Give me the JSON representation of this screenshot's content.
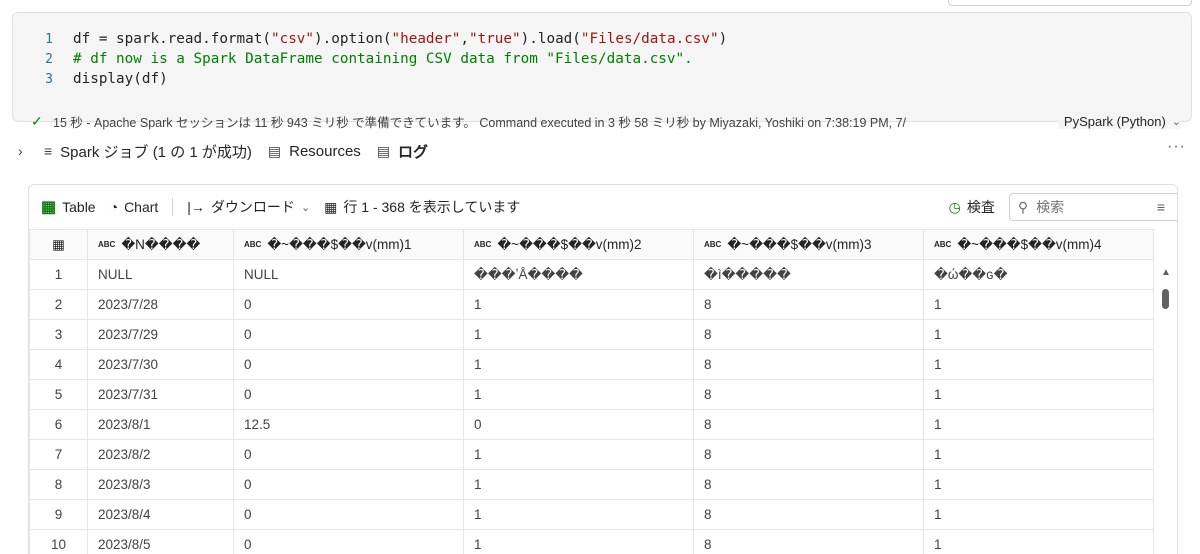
{
  "code": {
    "lines": [
      {
        "num": "1",
        "tokens": [
          {
            "t": "df = spark.read.format(",
            "c": "plain"
          },
          {
            "t": "\"csv\"",
            "c": "str"
          },
          {
            "t": ").option(",
            "c": "plain"
          },
          {
            "t": "\"header\"",
            "c": "str"
          },
          {
            "t": ",",
            "c": "plain"
          },
          {
            "t": "\"true\"",
            "c": "str"
          },
          {
            "t": ").load(",
            "c": "plain"
          },
          {
            "t": "\"Files/data.csv\"",
            "c": "str"
          },
          {
            "t": ")",
            "c": "plain"
          }
        ]
      },
      {
        "num": "2",
        "tokens": [
          {
            "t": "# df now is a Spark DataFrame containing CSV data from \"Files/data.csv\".",
            "c": "cmt"
          }
        ]
      },
      {
        "num": "3",
        "tokens": [
          {
            "t": "display(df)",
            "c": "plain"
          }
        ]
      }
    ]
  },
  "status": {
    "check_icon": "✓",
    "text": "15 秒 - Apache Spark セッションは 11 秒 943 ミリ秒 で準備できています。 Command executed in 3 秒 58 ミリ秒 by Miyazaki, Yoshiki on 7:38:19 PM, 7/",
    "language": "PySpark (Python)"
  },
  "jobs": {
    "expand_icon": "›",
    "jobs_label": "Spark ジョブ (1 の 1 が成功)",
    "resources_label": "Resources",
    "log_label": "ログ",
    "more_icon": "···"
  },
  "toolbar": {
    "table_label": "Table",
    "chart_label": "Chart",
    "download_label": "ダウンロード",
    "rows_info": "行 1 - 368 を表示しています",
    "inspect_label": "検査",
    "search_placeholder": "検索"
  },
  "table": {
    "type_badge": "ABC",
    "columns": [
      "�N����",
      "�~���$��v(mm)1",
      "�~���$��v(mm)2",
      "�~���$��v(mm)3",
      "�~���$��v(mm)4"
    ],
    "rows": [
      {
        "num": "1",
        "cells": [
          "NULL",
          "NULL",
          "���ʼÅ����",
          "�ì�����",
          "�ώ��ɢ�"
        ]
      },
      {
        "num": "2",
        "cells": [
          "2023/7/28",
          "0",
          "1",
          "8",
          "1"
        ]
      },
      {
        "num": "3",
        "cells": [
          "2023/7/29",
          "0",
          "1",
          "8",
          "1"
        ]
      },
      {
        "num": "4",
        "cells": [
          "2023/7/30",
          "0",
          "1",
          "8",
          "1"
        ]
      },
      {
        "num": "5",
        "cells": [
          "2023/7/31",
          "0",
          "1",
          "8",
          "1"
        ]
      },
      {
        "num": "6",
        "cells": [
          "2023/8/1",
          "12.5",
          "0",
          "8",
          "1"
        ]
      },
      {
        "num": "7",
        "cells": [
          "2023/8/2",
          "0",
          "1",
          "8",
          "1"
        ]
      },
      {
        "num": "8",
        "cells": [
          "2023/8/3",
          "0",
          "1",
          "8",
          "1"
        ]
      },
      {
        "num": "9",
        "cells": [
          "2023/8/4",
          "0",
          "1",
          "8",
          "1"
        ]
      },
      {
        "num": "10",
        "cells": [
          "2023/8/5",
          "0",
          "1",
          "8",
          "1"
        ]
      }
    ]
  },
  "colors": {
    "accent_green": "#107c10",
    "string": "#a31515",
    "comment": "#008000",
    "line_number": "#237893"
  }
}
